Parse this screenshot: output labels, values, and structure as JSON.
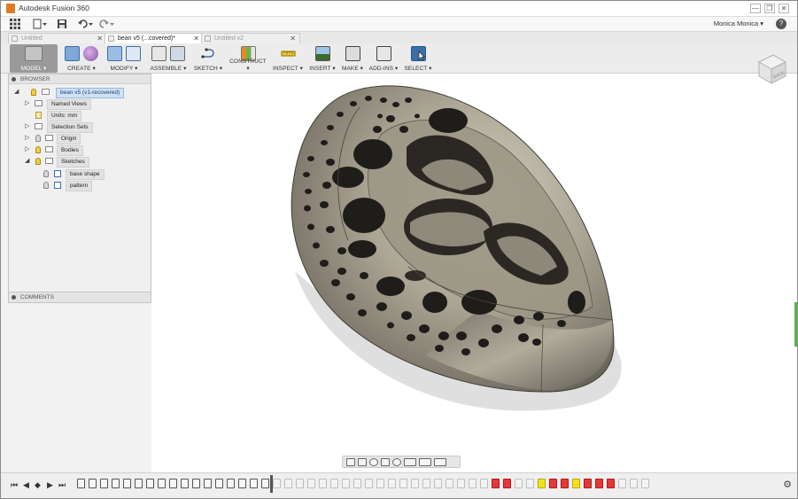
{
  "window": {
    "title": "Autodesk Fusion 360",
    "controls": {
      "minimize": "—",
      "restore": "❐",
      "close": "✕"
    }
  },
  "quickbar": {
    "user_name": "Monica Monica ▾",
    "help": "?"
  },
  "tabs": [
    {
      "label": "Untitled",
      "active": false
    },
    {
      "label": "bean v5 (...covered)*",
      "active": true
    },
    {
      "label": "Untitled v2",
      "active": false
    }
  ],
  "toolbar": {
    "groups": [
      {
        "label": "MODEL ▾",
        "icons": [
          "model-icon"
        ]
      },
      {
        "label": "CREATE ▾",
        "icons": [
          "box-icon",
          "sphere-mesh-icon"
        ]
      },
      {
        "label": "MODIFY ▾",
        "icons": [
          "press-pull-icon",
          "shell-icon"
        ]
      },
      {
        "label": "ASSEMBLE ▾",
        "icons": [
          "component-icon",
          "joint-icon"
        ]
      },
      {
        "label": "SKETCH ▾",
        "icons": [
          "sketch-icon"
        ]
      },
      {
        "label": "CONSTRUCT ▾",
        "icons": [
          "plane-icon"
        ]
      },
      {
        "label": "INSPECT ▾",
        "icons": [
          "measure-icon"
        ]
      },
      {
        "label": "INSERT ▾",
        "icons": [
          "image-icon"
        ]
      },
      {
        "label": "MAKE ▾",
        "icons": [
          "print-icon"
        ]
      },
      {
        "label": "ADD-INS ▾",
        "icons": [
          "addin-icon"
        ]
      },
      {
        "label": "SELECT ▾",
        "icons": [
          "cursor-icon"
        ]
      }
    ]
  },
  "browser": {
    "header": "BROWSER",
    "items": [
      {
        "label": "bean v5 (v1-recovered)",
        "arrow": "◢",
        "selected": true
      },
      {
        "label": "Named Views",
        "arrow": "▷"
      },
      {
        "label": "Units: mm",
        "arrow": ""
      },
      {
        "label": "Selection Sets",
        "arrow": "▷"
      },
      {
        "label": "Origin",
        "arrow": "▷"
      },
      {
        "label": "Bodies",
        "arrow": "▷"
      },
      {
        "label": "Sketches",
        "arrow": "◢"
      },
      {
        "label": "base shape",
        "arrow": ""
      },
      {
        "label": "pattern",
        "arrow": ""
      }
    ],
    "comments_header": "COMMENTS"
  },
  "viewcube": {
    "face_label": "BACK"
  },
  "timeline": {
    "controls": [
      "⏮",
      "◀",
      "◆",
      "▶",
      "⏭"
    ],
    "settings": "⚙"
  },
  "colors": {
    "accent": "#3a6fa8",
    "error": "#e23a3a",
    "warning": "#f2e21a",
    "model": "#8b8577"
  }
}
